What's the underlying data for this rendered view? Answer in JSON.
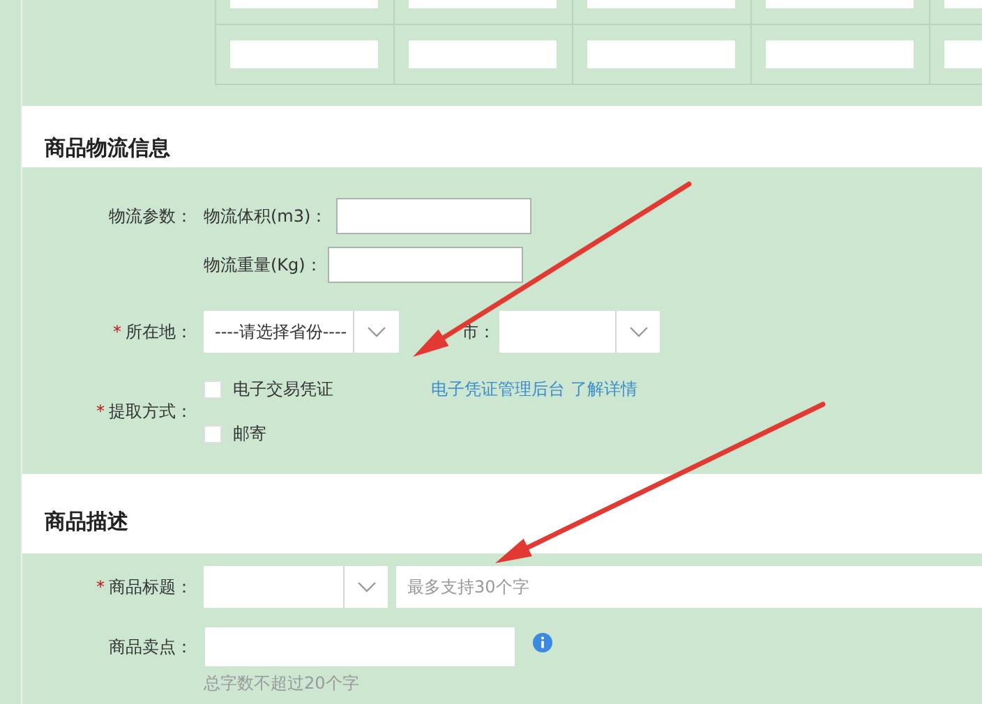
{
  "spec_table": {
    "rows": [
      {
        "cells": [
          {
            "kind": "input"
          },
          {
            "kind": "input"
          },
          {
            "kind": "input"
          },
          {
            "kind": "input"
          },
          {
            "kind": "input"
          }
        ]
      },
      {
        "cells": [
          {
            "kind": "input"
          },
          {
            "kind": "input"
          },
          {
            "kind": "input"
          },
          {
            "kind": "input"
          },
          {
            "kind": "input"
          }
        ]
      }
    ]
  },
  "logistics": {
    "title": "商品物流信息",
    "params_label": "物流参数：",
    "params": [
      {
        "label": "物流体积(m3)："
      },
      {
        "label": "物流重量(Kg)："
      }
    ],
    "location": {
      "marker": "*",
      "label": "所在地：",
      "province_placeholder": "----请选择省份----",
      "city_label": "市："
    },
    "pickup": {
      "marker": "*",
      "label": "提取方式：",
      "options": [
        {
          "label": "电子交易凭证",
          "checked": false
        },
        {
          "label": "邮寄",
          "checked": false
        }
      ],
      "links": [
        "电子凭证管理后台",
        "了解详情"
      ]
    }
  },
  "description": {
    "title": "商品描述",
    "title_field": {
      "marker": "*",
      "label": "商品标题：",
      "placeholder": "最多支持30个字"
    },
    "selling_point": {
      "label": "商品卖点：",
      "hint": "总字数不超过20个字"
    }
  },
  "annotations": [
    {
      "kind": "arrow"
    },
    {
      "kind": "arrow"
    }
  ]
}
